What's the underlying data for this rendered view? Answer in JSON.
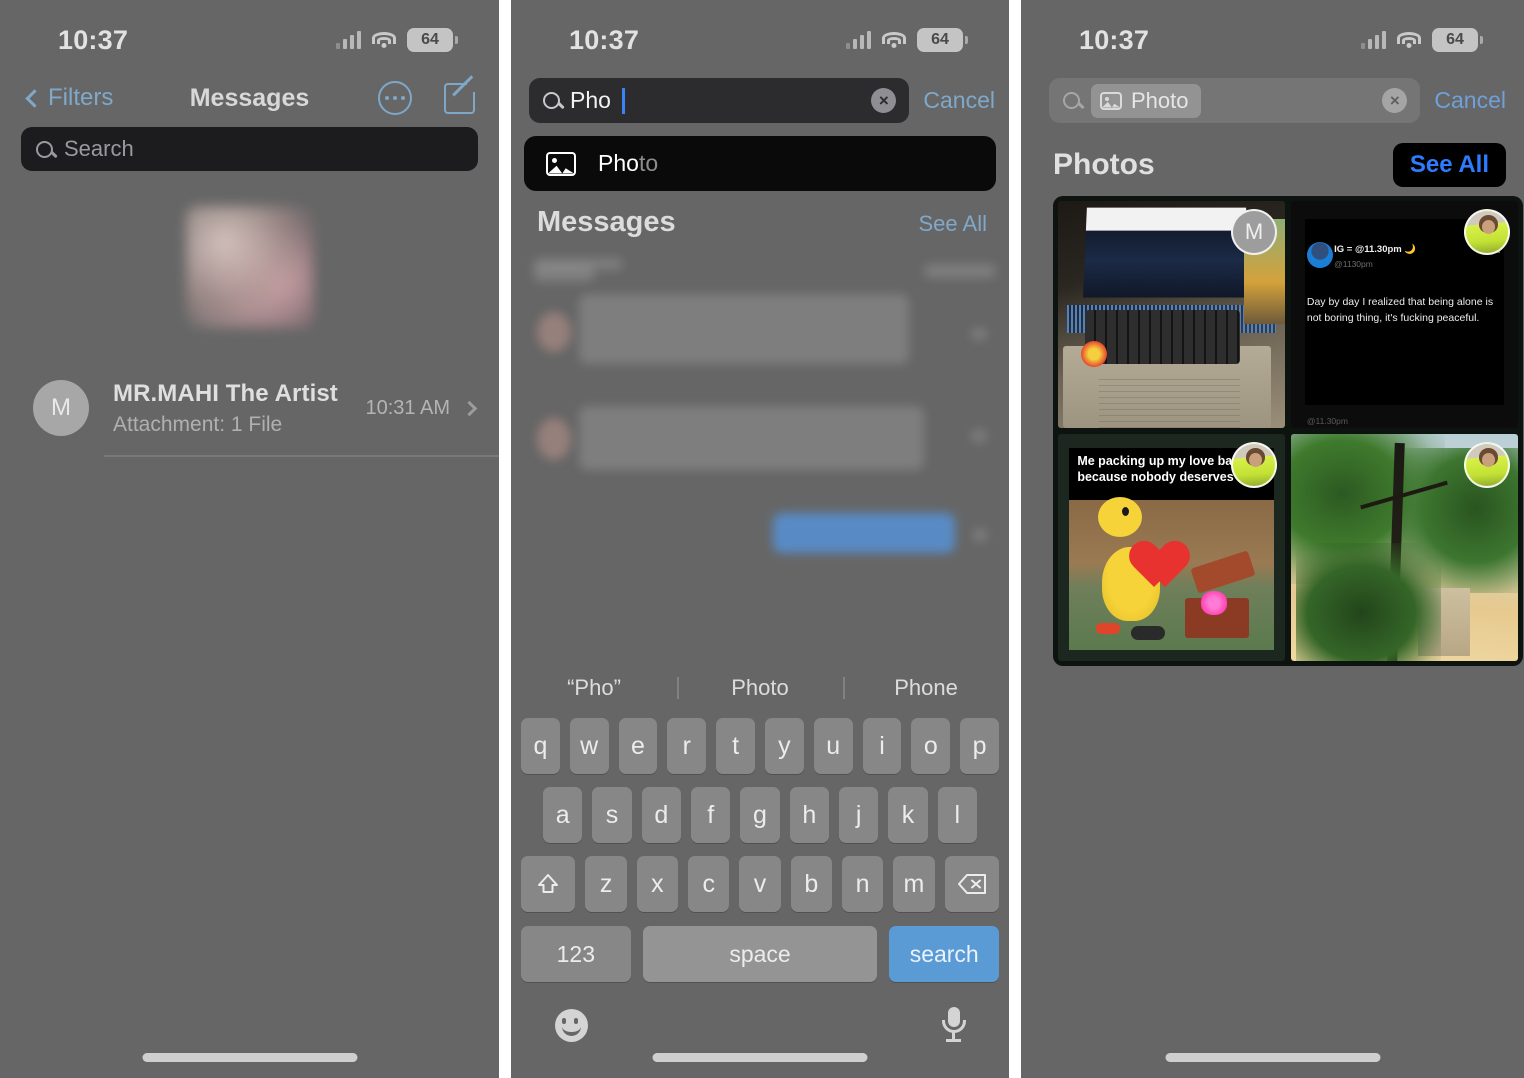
{
  "status_bar": {
    "time": "10:37",
    "battery": "64",
    "signal_icon": "cellular-bars-icon",
    "wifi_icon": "wifi-icon"
  },
  "panel1": {
    "nav": {
      "back_label": "Filters",
      "title": "Messages",
      "more_icon": "more-circle-icon",
      "compose_icon": "compose-icon"
    },
    "search": {
      "placeholder": "Search",
      "icon": "search-icon"
    },
    "conversation": {
      "avatar_initial": "M",
      "name": "MR.MAHI The Artist",
      "subtitle": "Attachment: 1 File",
      "time": "10:31 AM",
      "chevron_icon": "chevron-right-icon"
    }
  },
  "panel2": {
    "search": {
      "value": "Pho",
      "clear_icon": "clear-circle-icon",
      "cancel_label": "Cancel",
      "icon": "search-icon"
    },
    "suggestion": {
      "icon": "photo-icon",
      "typed": "Pho",
      "completion": "to"
    },
    "results_section": {
      "title": "Messages",
      "see_all_label": "See All"
    },
    "keyboard": {
      "predictions": [
        "“Pho”",
        "Photo",
        "Phone"
      ],
      "row1": [
        "q",
        "w",
        "e",
        "r",
        "t",
        "y",
        "u",
        "i",
        "o",
        "p"
      ],
      "row2": [
        "a",
        "s",
        "d",
        "f",
        "g",
        "h",
        "j",
        "k",
        "l"
      ],
      "row3": [
        "z",
        "x",
        "c",
        "v",
        "b",
        "n",
        "m"
      ],
      "shift_icon": "shift-arrow-icon",
      "delete_icon": "backspace-icon",
      "numbers_label": "123",
      "space_label": "space",
      "return_label": "search",
      "emoji_icon": "emoji-face-icon",
      "dictation_icon": "microphone-icon"
    }
  },
  "panel3": {
    "search": {
      "token_label": "Photo",
      "token_icon": "photo-icon",
      "clear_icon": "clear-circle-icon",
      "cancel_label": "Cancel",
      "icon": "search-icon"
    },
    "section": {
      "title": "Photos",
      "see_all_label": "See All"
    },
    "photos": [
      {
        "description": "Laptop on desk with audio editing software",
        "badge": "M",
        "badge_type": "initial"
      },
      {
        "description": "Dark Instagram text post screenshot",
        "badge": "contact-photo",
        "badge_type": "photo",
        "post_title": "IG = @11.30pm 🌙",
        "post_handle": "@1130pm",
        "post_body": "Day by day I realized that being alone is not boring thing, it's fucking peaceful.",
        "post_footer": "@11.30pm"
      },
      {
        "description": "Duck meme with hearts in a box",
        "badge": "contact-photo",
        "badge_type": "photo",
        "caption": "Me packing up my love back because nobody deserves it"
      },
      {
        "description": "Looking up at green trees against sky",
        "badge": "contact-photo",
        "badge_type": "photo"
      }
    ]
  },
  "colors": {
    "dim_overlay": "#666666",
    "accent_blue": "#3b82f6",
    "link_blue": "#7fa8c9",
    "highlight_blue": "#2f7bff",
    "field_dark": "#2c2c2e",
    "card_black": "#0a0a0a"
  }
}
